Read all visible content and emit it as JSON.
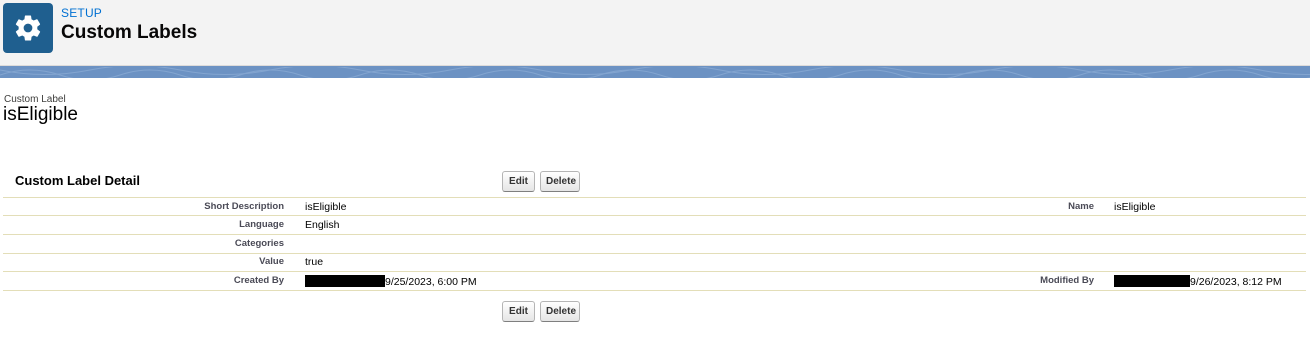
{
  "header": {
    "icon": "gear-icon",
    "breadcrumb": "SETUP",
    "title": "Custom Labels"
  },
  "record": {
    "type_label": "Custom Label",
    "name": "isEligible"
  },
  "detail": {
    "section_title": "Custom Label Detail",
    "edit_label": "Edit",
    "delete_label": "Delete",
    "fields": {
      "short_description": {
        "label": "Short Description",
        "value": "isEligible"
      },
      "name": {
        "label": "Name",
        "value": "isEligible"
      },
      "language": {
        "label": "Language",
        "value": "English"
      },
      "categories": {
        "label": "Categories",
        "value": ""
      },
      "value": {
        "label": "Value",
        "value": "true"
      },
      "created_by": {
        "label": "Created By",
        "value": "9/25/2023, 6:00 PM"
      },
      "modified_by": {
        "label": "Modified By",
        "value": "9/26/2023, 8:12 PM"
      }
    }
  },
  "colors": {
    "header_bg": "#f3f3f3",
    "icon_bg": "#1f5f8f",
    "breadcrumb": "#0070d2",
    "banner": "#6c92c3",
    "row_divider": "#e3deb8"
  }
}
